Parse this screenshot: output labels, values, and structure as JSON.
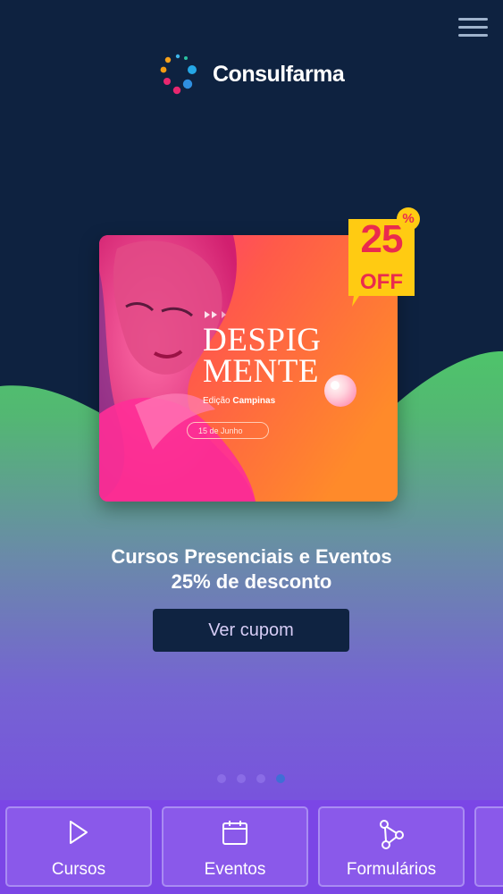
{
  "brand": {
    "name": "Consulfarma"
  },
  "header": {
    "menu_icon": "hamburger-menu-icon"
  },
  "carousel": {
    "banner": {
      "title_line1": "DESPIG",
      "title_line2": "MENTE",
      "edition_prefix": "Edição",
      "edition_city": "Campinas",
      "date": "15 de Junho",
      "badge_number": "25",
      "badge_off": "OFF",
      "badge_percent": "%"
    },
    "headline_line1": "Cursos Presenciais e Eventos",
    "headline_line2": "25% de desconto",
    "cta_label": "Ver cupom",
    "slides_total": 4,
    "active_slide": 4
  },
  "bottom_nav": {
    "items": [
      {
        "label": "Cursos",
        "icon": "play-icon"
      },
      {
        "label": "Eventos",
        "icon": "calendar-icon"
      },
      {
        "label": "Formulários",
        "icon": "nodes-icon"
      }
    ]
  },
  "colors": {
    "background_top": "#0e2240",
    "wave_green": "#4ec46a",
    "gradient_purple": "#7b46e6",
    "cta_bg": "#0f2341",
    "badge_yellow": "#ffcb12",
    "badge_red": "#ea2b4e"
  }
}
